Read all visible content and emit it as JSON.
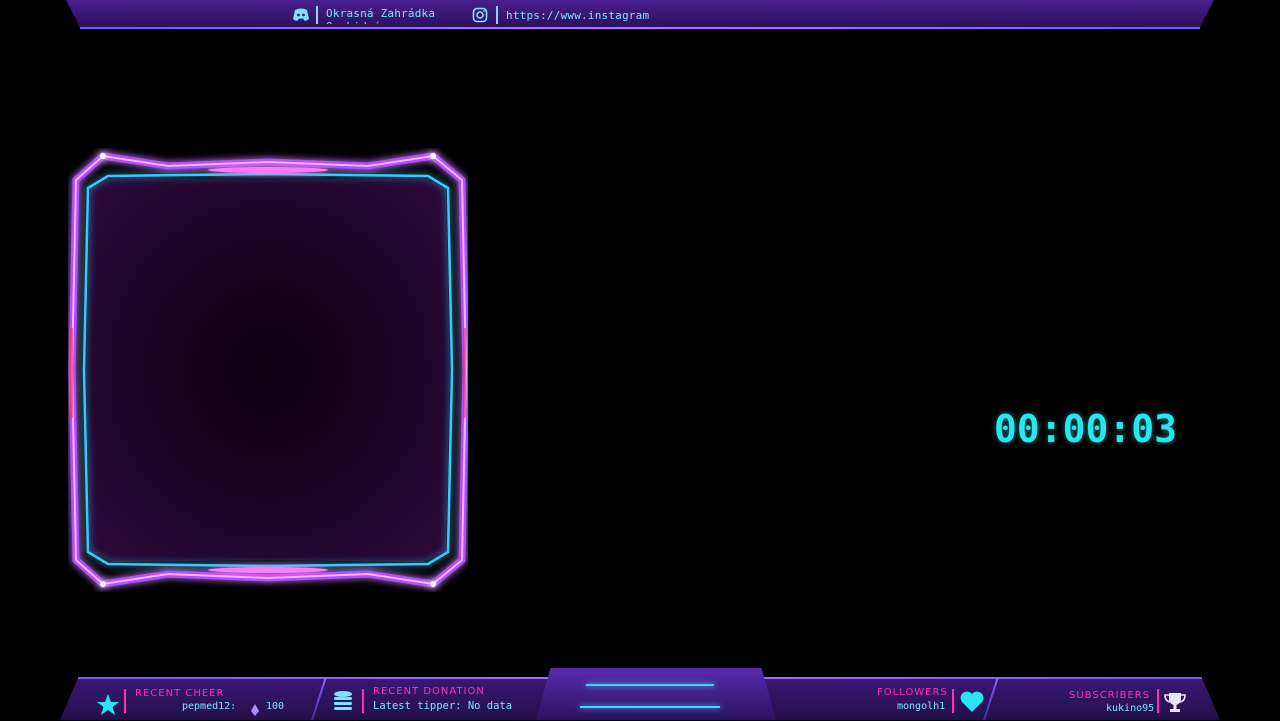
{
  "top_bar": {
    "discord_text": "Okrasná Zahrádka Ozobidoí",
    "instagram_text": "https://www.instagram",
    "discord_icon": "discord-icon",
    "instagram_icon": "instagram-icon"
  },
  "timer": {
    "value": "00:00:03"
  },
  "bottom_bar": {
    "recent_cheer": {
      "label": "RECENT CHEER",
      "user": "pepmed12:",
      "amount": "100",
      "icon": "star-icon"
    },
    "recent_donation": {
      "label": "RECENT DONATION",
      "value": "Latest tipper: No data",
      "icon": "coins-icon"
    },
    "followers": {
      "label": "FOLLOWERS",
      "value": "mongolh1",
      "icon": "heart-icon"
    },
    "subscribers": {
      "label": "SUBSCRIBERS",
      "value": "kukino95",
      "icon": "trophy-icon"
    }
  },
  "colors": {
    "accent_cyan": "#27e6f0",
    "accent_pink": "#ff2fb0",
    "frame_purple": "#b44dff",
    "bar_purple": "#3b1878"
  }
}
